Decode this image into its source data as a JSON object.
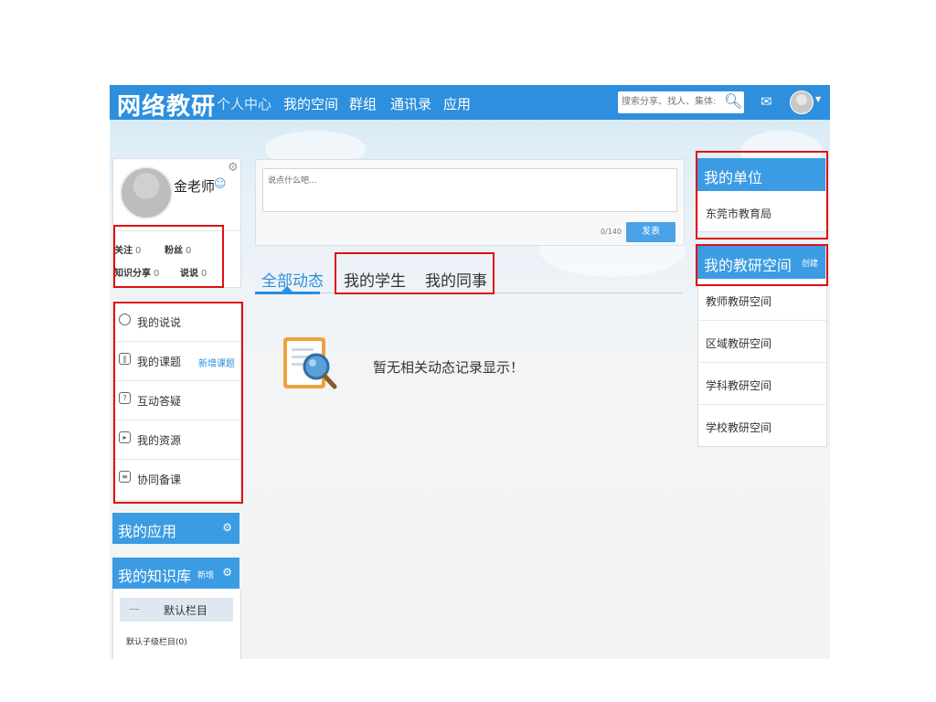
{
  "header": {
    "logo": "网络教研",
    "nav": [
      "个人中心",
      "我的空间",
      "群组",
      "通讯录",
      "应用"
    ],
    "search_placeholder": "搜索分享、找人、集体:"
  },
  "profile": {
    "name": "金老师",
    "stats": {
      "follow_label": "关注",
      "follow_count": "0",
      "fans_label": "粉丝",
      "fans_count": "0",
      "share_label": "知识分享",
      "share_count": "0",
      "talk_label": "说说",
      "talk_count": "0"
    }
  },
  "menu": {
    "items": [
      {
        "label": "我的说说",
        "icon": "chat-icon"
      },
      {
        "label": "我的课题",
        "icon": "book-icon",
        "extra": "新增课题"
      },
      {
        "label": "互动答疑",
        "icon": "question-icon"
      },
      {
        "label": "我的资源",
        "icon": "resource-icon"
      },
      {
        "label": "协同备课",
        "icon": "document-icon"
      }
    ]
  },
  "apps": {
    "title": "我的应用"
  },
  "knowledge": {
    "title": "我的知识库",
    "new_label": "新增",
    "default_column": "默认栏目",
    "default_dash": "—",
    "sub_column": "默认子级栏目(0)"
  },
  "post": {
    "placeholder": "说点什么吧...",
    "counter": "0/140",
    "publish_label": "发表"
  },
  "tabs": [
    "全部动态",
    "我的学生",
    "我的同事"
  ],
  "empty_message": "暂无相关动态记录显示！",
  "unit": {
    "title": "我的单位",
    "name": "东莞市教育局"
  },
  "research_space": {
    "title": "我的教研空间",
    "create_label": "创建",
    "items": [
      "教师教研空间",
      "区域教研空间",
      "学科教研空间",
      "学校教研空间"
    ]
  },
  "colors": {
    "brand": "#2d8fdd",
    "panel": "#3b9be3",
    "annotation": "#e01010"
  }
}
